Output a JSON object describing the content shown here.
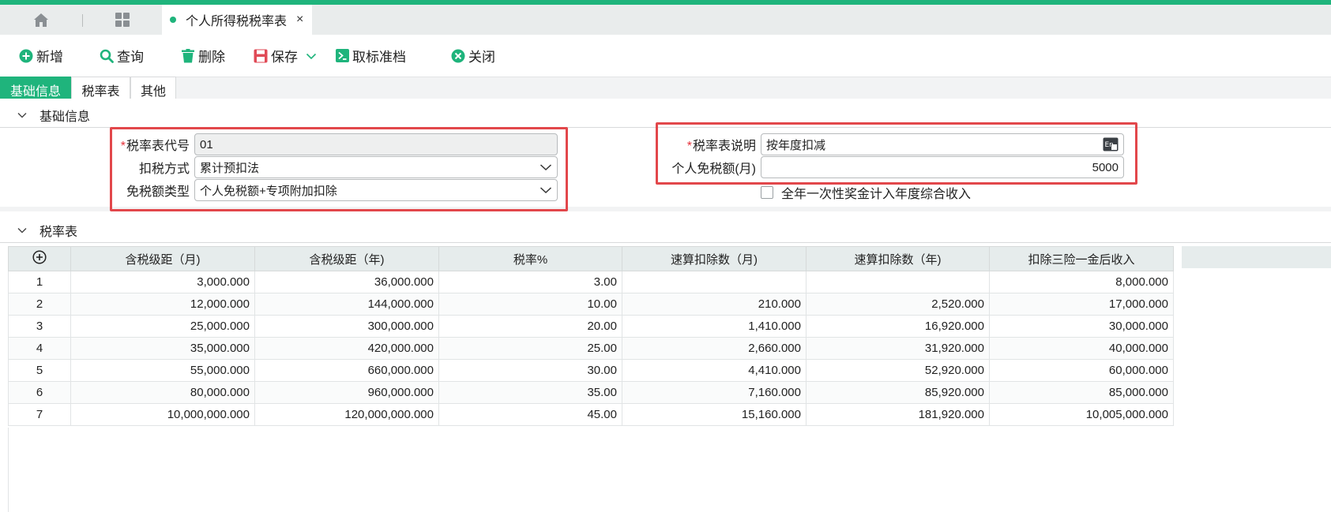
{
  "tabs": {
    "home_icon": "home-icon",
    "apps_icon": "apps-grid-icon",
    "active_title": "个人所得税税率表",
    "close": "×"
  },
  "toolbar": {
    "add": "新增",
    "query": "查询",
    "delete": "删除",
    "save": "保存",
    "unstandard": "取标准档",
    "close": "关闭"
  },
  "subtabs": [
    "基础信息",
    "税率表",
    "其他"
  ],
  "basic_section": {
    "title": "基础信息",
    "fields": {
      "code_label": "税率表代号",
      "code_value": "01",
      "method_label": "扣税方式",
      "method_value": "累计预扣法",
      "exempt_type_label": "免税额类型",
      "exempt_type_value": "个人免税额+专项附加扣除",
      "desc_label": "税率表说明",
      "desc_value": "按年度扣减",
      "exempt_amount_label": "个人免税额(月)",
      "exempt_amount_value": "5000",
      "bonus_checkbox_label": "全年一次性奖金计入年度综合收入",
      "bonus_checked": false
    }
  },
  "rate_section": {
    "title": "税率表",
    "columns": [
      "含税级距（月)",
      "含税级距（年)",
      "税率%",
      "速算扣除数（月)",
      "速算扣除数（年)",
      "扣除三险一金后收入"
    ],
    "rows": [
      [
        "1",
        "3,000.000",
        "36,000.000",
        "3.00",
        "",
        "",
        "8,000.000"
      ],
      [
        "2",
        "12,000.000",
        "144,000.000",
        "10.00",
        "210.000",
        "2,520.000",
        "17,000.000"
      ],
      [
        "3",
        "25,000.000",
        "300,000.000",
        "20.00",
        "1,410.000",
        "16,920.000",
        "30,000.000"
      ],
      [
        "4",
        "35,000.000",
        "420,000.000",
        "25.00",
        "2,660.000",
        "31,920.000",
        "40,000.000"
      ],
      [
        "5",
        "55,000.000",
        "660,000.000",
        "30.00",
        "4,410.000",
        "52,920.000",
        "60,000.000"
      ],
      [
        "6",
        "80,000.000",
        "960,000.000",
        "35.00",
        "7,160.000",
        "85,920.000",
        "85,000.000"
      ],
      [
        "7",
        "10,000,000.000",
        "120,000,000.000",
        "45.00",
        "15,160.000",
        "181,920.000",
        "10,005,000.000"
      ]
    ]
  },
  "colors": {
    "accent": "#1fb47c",
    "highlight": "#e2474b",
    "required": "#e5323b"
  }
}
